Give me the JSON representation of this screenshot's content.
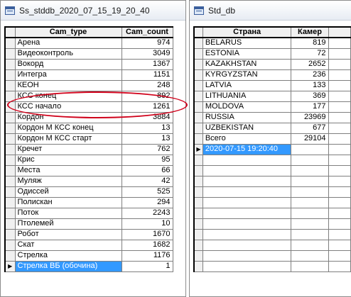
{
  "left_window": {
    "title": "Ss_stddb_2020_07_15_19_20_40",
    "columns": [
      "Cam_type",
      "Cam_count"
    ],
    "rows": [
      [
        "Арена",
        "974"
      ],
      [
        "Видеоконтроль",
        "3049"
      ],
      [
        "Вокорд",
        "1367"
      ],
      [
        "Интегра",
        "1151"
      ],
      [
        "КЕОН",
        "248"
      ],
      [
        "КСС конец",
        "892"
      ],
      [
        "КСС начало",
        "1261"
      ],
      [
        "Кордон",
        "3884"
      ],
      [
        "Кордон М КСС конец",
        "13"
      ],
      [
        "Кордон М КСС старт",
        "13"
      ],
      [
        "Кречет",
        "762"
      ],
      [
        "Крис",
        "95"
      ],
      [
        "Места",
        "66"
      ],
      [
        "Муляж",
        "42"
      ],
      [
        "Одиссей",
        "525"
      ],
      [
        "Полискан",
        "294"
      ],
      [
        "Поток",
        "2243"
      ],
      [
        "Птолемей",
        "10"
      ],
      [
        "Робот",
        "1670"
      ],
      [
        "Скат",
        "1682"
      ],
      [
        "Стрелка",
        "1176"
      ],
      [
        "Стрелка ВБ (обочина)",
        "1"
      ]
    ],
    "current_row": 21,
    "row_pointer": "▶"
  },
  "right_window": {
    "title": "Std_db",
    "columns": [
      "Страна",
      "Камер"
    ],
    "rows": [
      [
        "BELARUS",
        "819"
      ],
      [
        "ESTONIA",
        "72"
      ],
      [
        "KAZAKHSTAN",
        "2652"
      ],
      [
        "KYRGYZSTAN",
        "236"
      ],
      [
        "LATVIA",
        "133"
      ],
      [
        "LITHUANIA",
        "369"
      ],
      [
        "MOLDOVA",
        "177"
      ],
      [
        "RUSSIA",
        "23969"
      ],
      [
        "UZBEKISTAN",
        "677"
      ],
      [
        "Всего",
        "29104"
      ],
      [
        "2020-07-15 19:20:40",
        ""
      ]
    ],
    "empty_rows": 11,
    "current_row": 10,
    "row_pointer": "▶"
  },
  "annotation": {
    "color": "#d0021b",
    "highlighted_rows": [
      "КСС конец",
      "КСС начало"
    ]
  },
  "icons": {
    "window_icon": "table-window-icon"
  }
}
